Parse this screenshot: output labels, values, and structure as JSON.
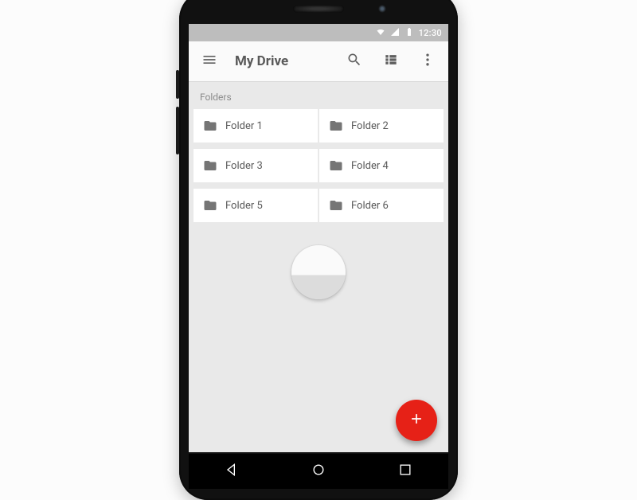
{
  "status": {
    "time": "12:30"
  },
  "appbar": {
    "title": "My Drive"
  },
  "section": {
    "folders_label": "Folders"
  },
  "folders": [
    {
      "name": "Folder 1"
    },
    {
      "name": "Folder 2"
    },
    {
      "name": "Folder 3"
    },
    {
      "name": "Folder 4"
    },
    {
      "name": "Folder 5"
    },
    {
      "name": "Folder 6"
    }
  ],
  "colors": {
    "fab": "#e62117",
    "appbar_bg": "#fafafa",
    "screen_bg": "#e9e9e9"
  }
}
